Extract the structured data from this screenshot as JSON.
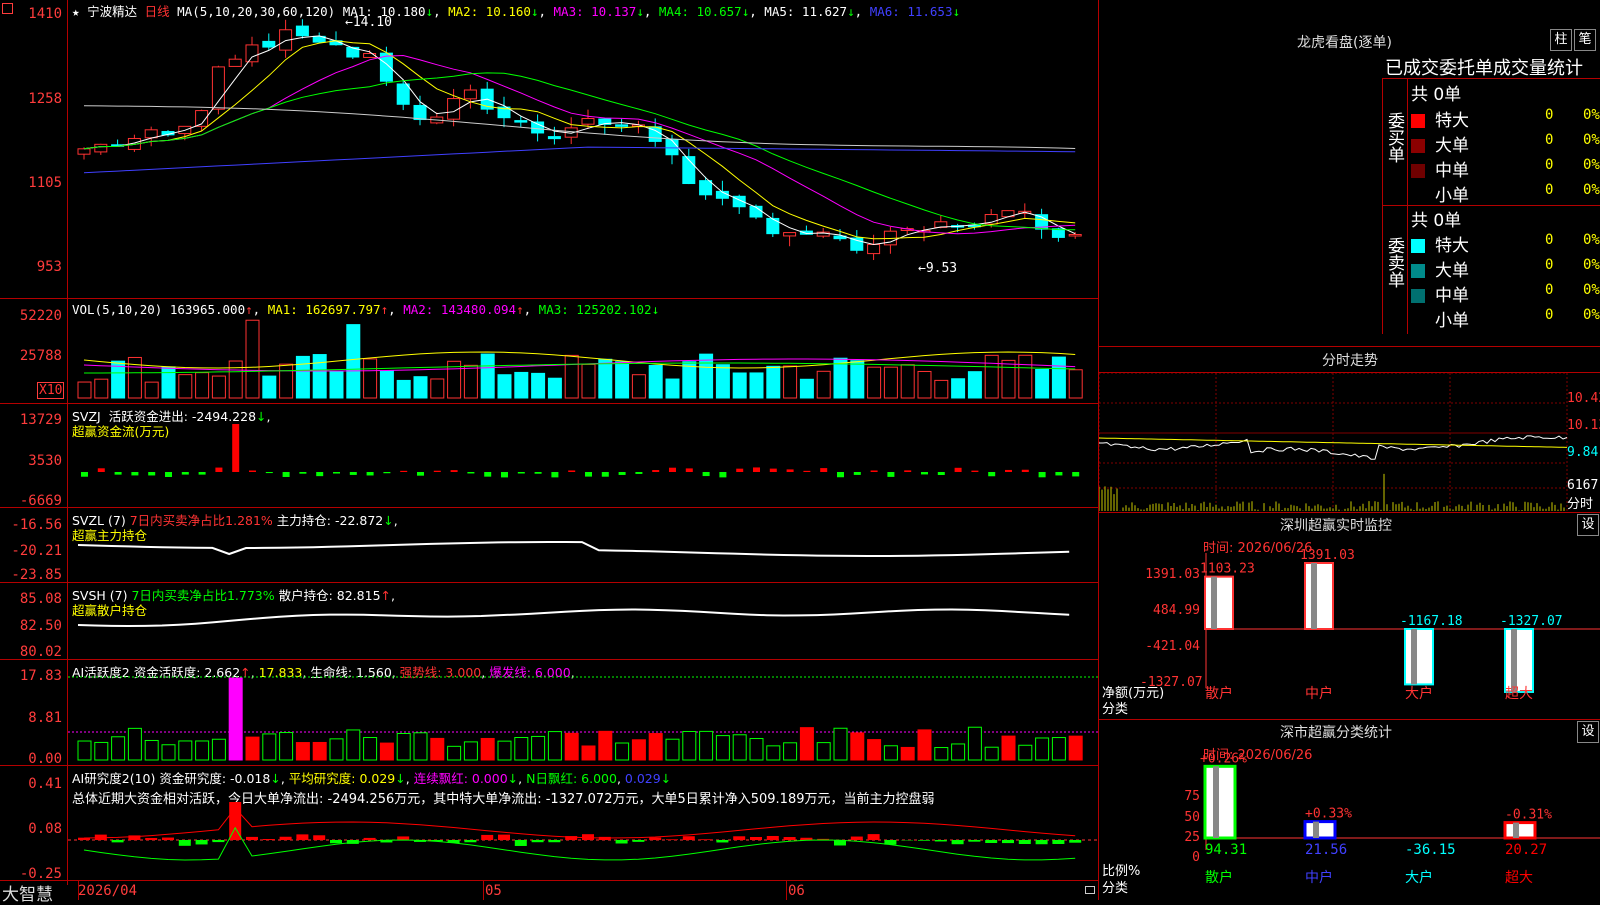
{
  "header": {
    "star": "★",
    "stock_name": "宁波精达",
    "period": "日线",
    "ma_title": "MA(5,10,20,30,60,120)",
    "ma1": "MA1: 10.180",
    "ma2": "MA2: 10.160",
    "ma3": "MA3: 10.137",
    "ma4": "MA4: 10.657",
    "ma5": "MA5: 11.627",
    "ma6": "MA6: 11.653",
    "high_marker": "14.10",
    "low_marker": "9.53"
  },
  "price_axis": [
    "1410",
    "1258",
    "1105",
    "953"
  ],
  "vol": {
    "title": "VOL(5,10,20)",
    "value": "163965.000",
    "ma1": "MA1: 162697.797",
    "ma2": "MA2: 143480.094",
    "ma3": "MA3: 125202.102",
    "axis": [
      "52220",
      "25788"
    ],
    "unit": "X10"
  },
  "svzj": {
    "title": "SVZJ",
    "text": "活跃资金进出: -2494.228",
    "sub": "超赢资金流(万元)",
    "axis": [
      "13729",
      "3530",
      "-6669"
    ]
  },
  "svzl": {
    "title": "SVZL (7)",
    "text1": "7日内买卖净占比1.281%",
    "text2": "主力持仓: -22.872",
    "sub": "超赢主力持仓",
    "axis": [
      "-16.56",
      "-20.21",
      "-23.85"
    ]
  },
  "svsh": {
    "title": "SVSH (7)",
    "text1": "7日内买卖净占比1.773%",
    "text2": "散户持仓: 82.815",
    "sub": "超赢散户持仓",
    "axis": [
      "85.08",
      "82.50",
      "80.02"
    ]
  },
  "ai1": {
    "title": "AI活跃度2",
    "t1": "资金活跃度: 2.662",
    "t2": "17.833",
    "t3": "生命线: 1.560",
    "t4": "强势线: 3.000",
    "t5": "爆发线: 6.000",
    "axis": [
      "17.83",
      "8.81",
      "0.00"
    ]
  },
  "ai2": {
    "title": "AI研究度2(10)",
    "t1": "资金研究度: -0.018",
    "t2": "平均研究度: 0.029",
    "t3": "连续飘红: 0.000",
    "t4": "N日飘红: 6.000",
    "t5": "0.029",
    "summary": "总体近期大资金相对活跃，今日大单净流出: -2494.256万元，其中特大单净流出: -1327.072万元，大单5日累计净入509.189万元，当前主力控盘弱",
    "axis": [
      "0.41",
      "0.08",
      "-0.25"
    ]
  },
  "xaxis": {
    "left": "大智慧",
    "d1": "2026/04",
    "d2": "05",
    "d3": "06"
  },
  "right": {
    "lhb_title": "龙虎看盘(逐单)",
    "btn_zhu": "柱",
    "btn_bi": "笔",
    "stat_title": "已成交委托单成交量统计",
    "buy_label": "委买单",
    "sell_label": "委卖单",
    "buy_total": "共 0单",
    "sell_total": "共 0单",
    "rows": [
      {
        "name": "特大",
        "num": "0",
        "pct": "0%"
      },
      {
        "name": "大单",
        "num": "0",
        "pct": "0%"
      },
      {
        "name": "中单",
        "num": "0",
        "pct": "0%"
      },
      {
        "name": "小单",
        "num": "0",
        "pct": "0%"
      }
    ],
    "buy_colors": [
      "#ff0000",
      "#8b0000",
      "#700000",
      "#000000"
    ],
    "sell_colors": [
      "#00ffff",
      "#008b8b",
      "#007070",
      "#000000"
    ],
    "intraday_title": "分时走势",
    "intraday_axis": [
      "10.42",
      "10.13",
      "9.84",
      "6167",
      "分时"
    ],
    "monitor_title": "深圳超赢实时监控",
    "monitor_btn": "设",
    "monitor_time": "时间: 2026/06/26",
    "monitor_axis": [
      "1391.03",
      "484.99",
      "-421.04",
      "-1327.07"
    ],
    "monitor_unit": "净额(万元)",
    "monitor_cat": "分类",
    "monitor_bars": [
      {
        "cat": "散户",
        "value": 1103.23,
        "label": "1103.23"
      },
      {
        "cat": "中户",
        "value": 1391.03,
        "label": "1391.03"
      },
      {
        "cat": "大户",
        "value": -1167.18,
        "label": "-1167.18"
      },
      {
        "cat": "超大",
        "value": -1327.07,
        "label": "-1327.07"
      }
    ],
    "class_title": "深市超赢分类统计",
    "class_btn": "设",
    "class_time": "时间: 2026/06/26",
    "class_axis": [
      "75",
      "50",
      "25",
      "0"
    ],
    "class_unit": "比例%",
    "class_cat": "分类",
    "class_bars": [
      {
        "cat": "散户",
        "value": 94.31,
        "top": "+0.26%",
        "bottom": "94.31"
      },
      {
        "cat": "中户",
        "value": 21.56,
        "top": "+0.33%",
        "bottom": "21.56"
      },
      {
        "cat": "大户",
        "value": -36.15,
        "top": "",
        "bottom": "-36.15"
      },
      {
        "cat": "超大",
        "value": 20.27,
        "top": "-0.31%",
        "bottom": "20.27"
      }
    ]
  }
}
